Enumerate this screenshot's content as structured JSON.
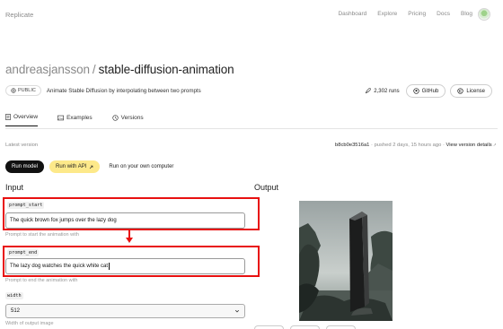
{
  "nav": {
    "brand": "Replicate",
    "links": [
      "Dashboard",
      "Explore",
      "Pricing",
      "Docs",
      "Blog"
    ]
  },
  "model": {
    "owner": "andreasjansson",
    "separator": "/",
    "name": "stable-diffusion-animation",
    "visibility": "PUBLIC",
    "description": "Animate Stable Diffusion by interpolating between two prompts",
    "runs": "2,302 runs",
    "github": "GitHub",
    "license": "License"
  },
  "tabs": [
    "Overview",
    "Examples",
    "Versions"
  ],
  "version": {
    "label": "Latest version",
    "hash": "b8cb0e3516a1",
    "pushed": " · pushed 2 days, 15 hours ago · ",
    "view_link": "View version details",
    "view_arrow": "↑"
  },
  "run_buttons": {
    "run_model": "Run model",
    "run_api": "Run with API",
    "run_own": "Run on your own computer"
  },
  "input": {
    "heading": "Input",
    "prompt_start": {
      "name": "prompt_start",
      "value": "The quick brown fox jumps over the lazy dog",
      "hint": "Prompt to start the animation with"
    },
    "prompt_end": {
      "name": "prompt_end",
      "value": "The lazy dog watches the quick white cat",
      "hint": "Prompt to end the animation with"
    },
    "width": {
      "name": "width",
      "value": "512",
      "hint": "Width of output image"
    }
  },
  "output": {
    "heading": "Output"
  },
  "colors": {
    "highlight": "#e81010",
    "api_button": "#fde98a",
    "run_button": "#111111"
  }
}
